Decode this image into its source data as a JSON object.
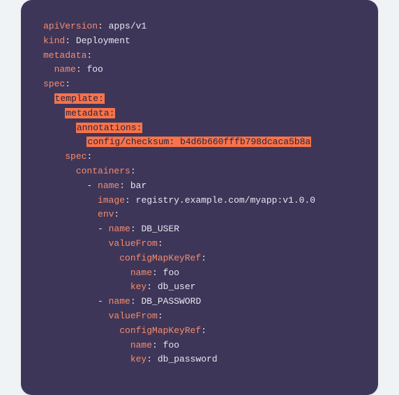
{
  "yaml": {
    "apiVersion_key": "apiVersion",
    "apiVersion_val": "apps/v1",
    "kind_key": "kind",
    "kind_val": "Deployment",
    "metadata_key": "metadata",
    "metadata_name_key": "name",
    "metadata_name_val": "foo",
    "spec_key": "spec",
    "template_key": "template",
    "tpl_metadata_key": "metadata",
    "annotations_key": "annotations",
    "checksum_key": "config/checksum",
    "checksum_val": "b4d6b660fffb798dcaca5b8a",
    "tpl_spec_key": "spec",
    "containers_key": "containers",
    "c_name_key": "name",
    "c_name_val": "bar",
    "image_key": "image",
    "image_val": "registry.example.com/myapp:v1.0.0",
    "env_key": "env",
    "env0_name_key": "name",
    "env0_name_val": "DB_USER",
    "env0_vf_key": "valueFrom",
    "env0_cmkr_key": "configMapKeyRef",
    "env0_cm_name_key": "name",
    "env0_cm_name_val": "foo",
    "env0_cm_key_key": "key",
    "env0_cm_key_val": "db_user",
    "env1_name_key": "name",
    "env1_name_val": "DB_PASSWORD",
    "env1_vf_key": "valueFrom",
    "env1_cmkr_key": "configMapKeyRef",
    "env1_cm_name_key": "name",
    "env1_cm_name_val": "foo",
    "env1_cm_key_key": "key",
    "env1_cm_key_val": "db_password"
  }
}
